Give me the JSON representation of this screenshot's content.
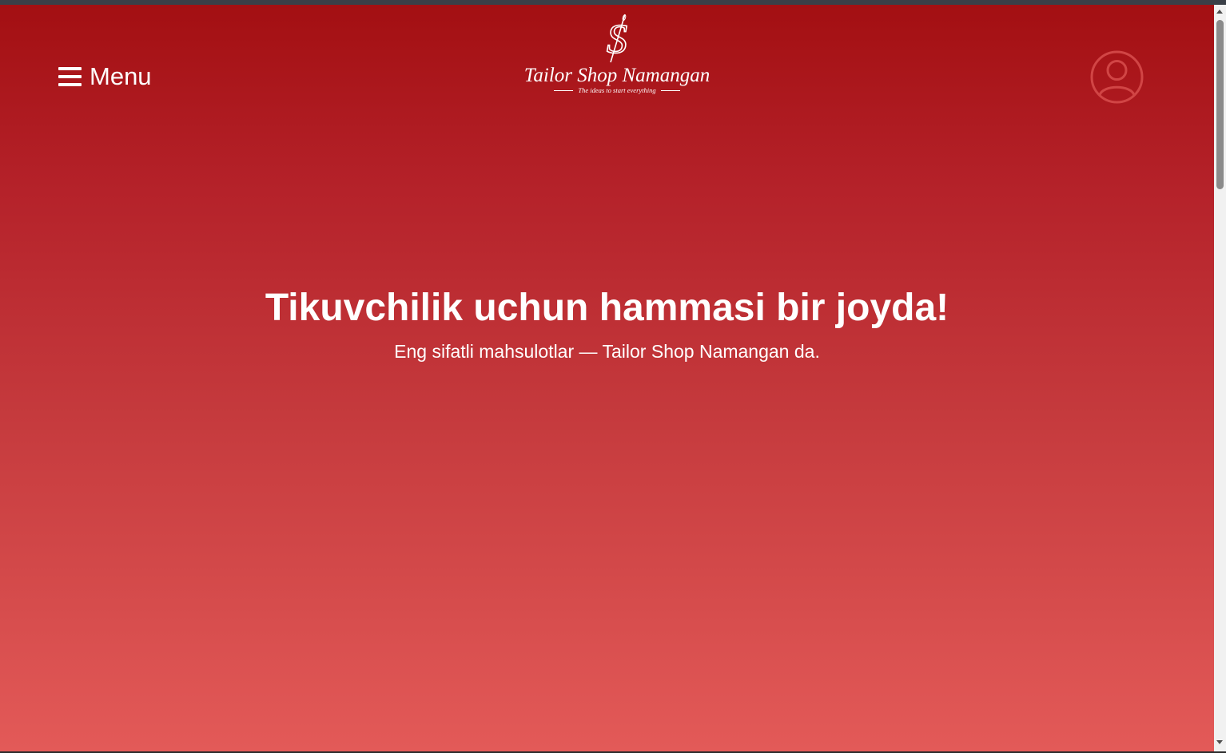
{
  "header": {
    "menu_label": "Menu",
    "logo": {
      "name": "Tailor Shop Namangan",
      "tagline": "The ideas to  start everything",
      "monogram": "S"
    },
    "profile_icon": "user-circle-icon"
  },
  "hero": {
    "title": "Tikuvchilik uchun hammasi bir joyda!",
    "subtitle": "Eng sifatli mahsulotlar — Tailor Shop Namangan da."
  },
  "colors": {
    "gradient_top": "#a30f12",
    "gradient_bottom": "#e35a58",
    "text": "#ffffff",
    "profile_icon": "#d14545"
  }
}
